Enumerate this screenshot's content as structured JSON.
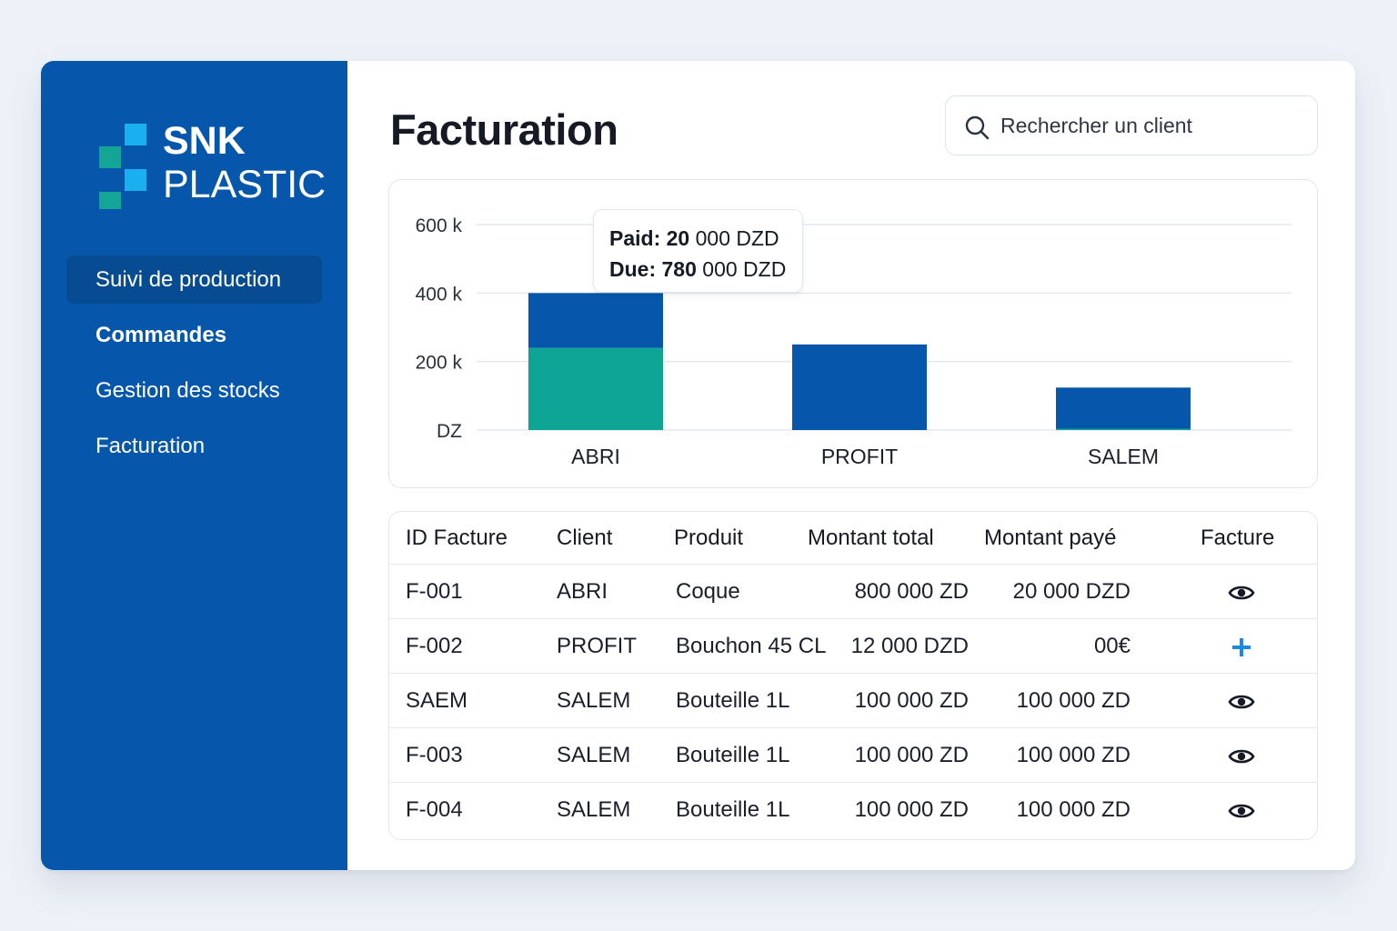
{
  "brand": {
    "name_line1": "SNK",
    "name_line2": "PLASTIC",
    "colors": {
      "sidebar": "#0657ab",
      "logo_light": "#1ab0f0",
      "logo_teal": "#15a596"
    }
  },
  "sidebar": {
    "items": [
      {
        "label": "Suivi de production",
        "active": true
      },
      {
        "label": "Commandes",
        "active": false
      },
      {
        "label": "Gestion des stocks",
        "active": false
      },
      {
        "label": "Facturation",
        "active": false
      }
    ]
  },
  "header": {
    "title": "Facturation",
    "search_placeholder": "Rechercher un client",
    "search_icon": "search-icon"
  },
  "tooltip": {
    "paid_label": "Paid:",
    "paid_bold": "20",
    "paid_rest": "000 DZD",
    "due_label": "Due:",
    "due_bold": "780",
    "due_rest": "000 DZD"
  },
  "chart_data": {
    "type": "bar",
    "stacked": true,
    "categories": [
      "ABRI",
      "PROFIT",
      "SALEM"
    ],
    "series": [
      {
        "color": "#0ea596",
        "values": [
          240000,
          0,
          4000
        ]
      },
      {
        "color": "#0657ab",
        "values": [
          160000,
          250000,
          120000
        ]
      }
    ],
    "y_tick_labels": [
      "DZ",
      "200 k",
      "400 k",
      "600 k"
    ],
    "y_ticks": [
      0,
      200000,
      400000,
      600000
    ],
    "ylim": [
      0,
      600000
    ],
    "grid": true
  },
  "table": {
    "headers": [
      "ID Facture",
      "Client",
      "Produit",
      "Montant total",
      "Montant payé",
      "Facture"
    ],
    "rows": [
      {
        "id": "F-001",
        "client": "ABRI",
        "produit": "Coque",
        "total": "800 000 ZD",
        "paye": "20 000 DZD",
        "action": "eye-icon"
      },
      {
        "id": "F-002",
        "client": "PROFIT",
        "produit": "Bouchon 45 CL",
        "total": "12 000 DZD",
        "paye": "00€",
        "action": "plus-icon"
      },
      {
        "id": "SAEM",
        "client": "SALEM",
        "produit": "Bouteille 1L",
        "total": "100 000 ZD",
        "paye": "100 000 ZD",
        "action": "eye-icon"
      },
      {
        "id": "F-003",
        "client": "SALEM",
        "produit": "Bouteille 1L",
        "total": "100 000 ZD",
        "paye": "100 000 ZD",
        "action": "eye-icon"
      },
      {
        "id": "F-004",
        "client": "SALEM",
        "produit": "Bouteille 1L",
        "total": "100 000 ZD",
        "paye": "100 000 ZD",
        "action": "eye-icon"
      }
    ]
  }
}
